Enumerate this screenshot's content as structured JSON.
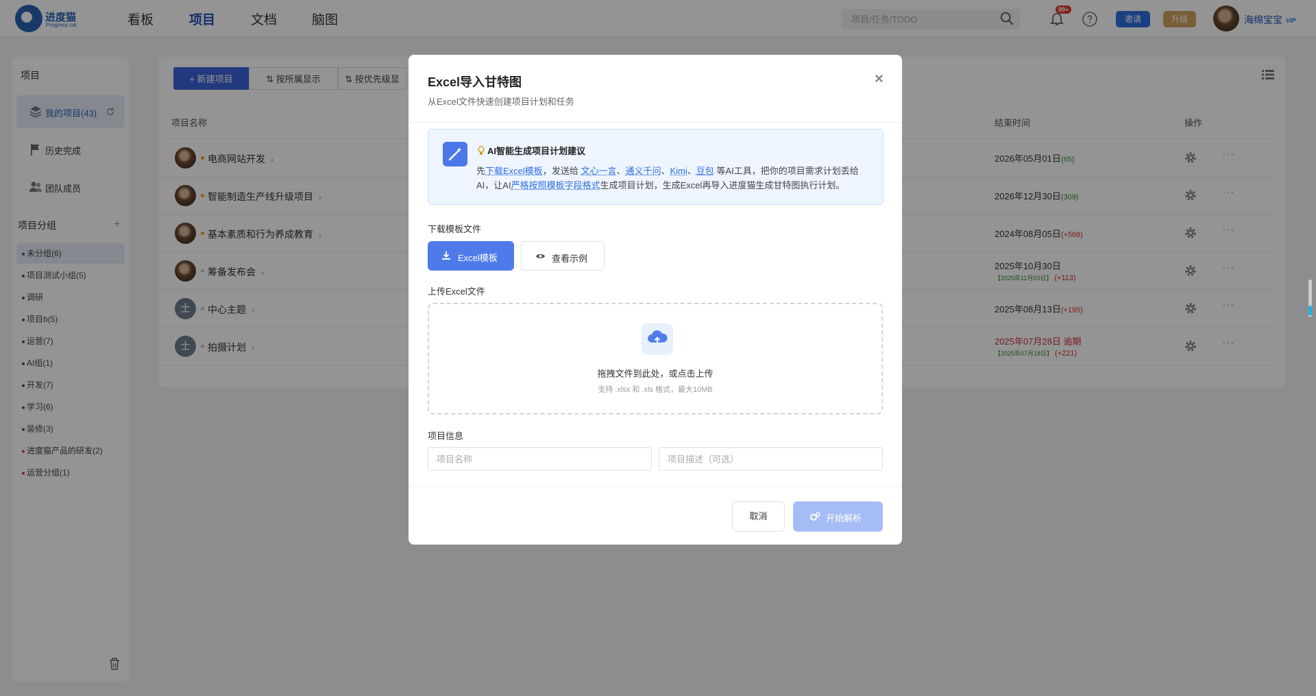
{
  "app": {
    "logo_text": "进度猫",
    "logo_sub": "Progress cat"
  },
  "nav": {
    "items": [
      "看板",
      "项目",
      "文档",
      "脑图"
    ],
    "active": "项目"
  },
  "search": {
    "placeholder": "项目/任务/TODO"
  },
  "notifications": {
    "badge": "99+"
  },
  "header_buttons": {
    "invite": "邀请",
    "upgrade": "升级"
  },
  "user": {
    "name": "海绵宝宝",
    "vip": "VIP"
  },
  "sidebar": {
    "title": "项目",
    "items": [
      {
        "label": "我的项目(43)",
        "icon": "layers-icon",
        "active": true
      },
      {
        "label": "历史完成",
        "icon": "flag-icon"
      },
      {
        "label": "团队成员",
        "icon": "team-icon"
      }
    ],
    "group_title": "项目分组",
    "add": "+",
    "groups": [
      {
        "label": "未分组(6)",
        "active": true,
        "dot": "default"
      },
      {
        "label": "项目测试小组(5)",
        "dot": "default"
      },
      {
        "label": "调研",
        "dot": "default"
      },
      {
        "label": "项目b(5)",
        "dot": "default"
      },
      {
        "label": "运营(7)",
        "dot": "default"
      },
      {
        "label": "AI组(1)",
        "dot": "default"
      },
      {
        "label": "开发(7)",
        "dot": "default"
      },
      {
        "label": "学习(6)",
        "dot": "default"
      },
      {
        "label": "装修(3)",
        "dot": "default"
      },
      {
        "label": "进度猫产品的研发(2)",
        "dot": "red"
      },
      {
        "label": "运营分组(1)",
        "dot": "red"
      }
    ]
  },
  "toolbar": {
    "new_project": "+ 新建项目",
    "by_owner": "按所属显示",
    "by_priority": "按优先级显"
  },
  "table": {
    "headers": {
      "name": "项目名称",
      "end": "结束时间",
      "ops": "操作"
    },
    "rows": [
      {
        "name": "电商网站开发",
        "avatar": "photo",
        "dot_color": "#f0a020",
        "end": "2026年05月01日",
        "delta": "(65)",
        "delta_color": "#2e8b2e"
      },
      {
        "name": "智能制造生产线升级项目",
        "avatar": "photo",
        "dot_color": "#f0a020",
        "end": "2026年12月30日",
        "delta": "(309)",
        "delta_color": "#2e8b2e"
      },
      {
        "name": "基本素质和行为养成教育",
        "avatar": "photo",
        "dot_color": "#f0a020",
        "end": "2024年08月05日",
        "delta": "(+568)",
        "delta_color": "#d32f2f"
      },
      {
        "name": "筹备发布会",
        "avatar": "photo",
        "dot_color": "#c0c4cc",
        "end": "2025年10月30日",
        "sub_green": "【2025年11月03日】",
        "sub_red": "(+113)"
      },
      {
        "name": "中心主题",
        "avatar": "generic",
        "avatar_text": "士",
        "dot_color": "#c0c4cc",
        "end": "2025年08月13日",
        "delta": "(+195)",
        "delta_color": "#d32f2f"
      },
      {
        "name": "拍摄计划",
        "avatar": "generic",
        "avatar_text": "士",
        "dot_color": "#c0c4cc",
        "end": "2025年07月28日 逾期",
        "end_color": "#d32f2f",
        "sub_green": "【2025年07月18日】",
        "sub_red": "(+221)"
      }
    ]
  },
  "modal": {
    "title": "Excel导入甘特图",
    "subtitle": "从Excel文件快速创建项目计划和任务",
    "close": "×",
    "ai": {
      "title": "AI智能生成项目计划建议",
      "t1": "先",
      "l1": "下载Excel模板",
      "t2": "，发送给 ",
      "l2": "文心一言",
      "t3": "、",
      "l3": "通义千问",
      "t4": "、",
      "l4": "Kimi",
      "t5": "、",
      "l5": "豆包",
      "t6": " 等AI工具，把你的项目需求计划丢给AI，让AI",
      "l6": "严格按照模板字段格式",
      "t7": "生成项目计划，生成Excel再导入进度猫生成甘特图执行计划。"
    },
    "download_label": "下载模板文件",
    "btn_excel": "Excel模板",
    "btn_example": "查看示例",
    "upload_label": "上传Excel文件",
    "drop_main": "拖拽文件到此处，或点击上传",
    "drop_sub": "支持 .xlsx 和 .xls 格式，最大10MB",
    "info_label": "项目信息",
    "name_placeholder": "项目名称",
    "desc_placeholder": "项目描述（可选）",
    "cancel": "取消",
    "parse": "开始解析"
  }
}
